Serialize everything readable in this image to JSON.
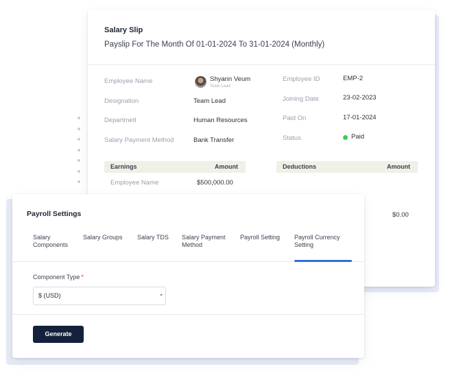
{
  "salary_slip": {
    "title": "Salary Slip",
    "subtitle": "Payslip For The Month Of 01-01-2024 To 31-01-2024 (Monthly)",
    "employee_name_label": "Employee Name",
    "employee_name": "Shyann Veum",
    "employee_role": "Team Lead",
    "designation_label": "Designation",
    "designation": "Team Lead",
    "department_label": "Departmetl",
    "department": "Human Resources",
    "payment_method_label": "Salary Payment Method",
    "payment_method": "Bank Transfer",
    "employee_id_label": "Employee ID",
    "employee_id": "EMP-2",
    "joining_date_label": "Joining Date",
    "joining_date": "23-02-2023",
    "paid_on_label": "Paid On",
    "paid_on": "17-01-2024",
    "status_label": "Status",
    "status": "Paid",
    "status_color": "#3ccf4e",
    "earnings": {
      "header_left": "Earnings",
      "header_right": "Amount",
      "rows": [
        {
          "label": "Employee Name",
          "amount": "$500,000.00"
        }
      ]
    },
    "deductions": {
      "header_left": "Deductions",
      "header_right": "Amount",
      "total": "$0.00"
    }
  },
  "payroll_settings": {
    "title": "Payroll Settings",
    "tabs": [
      {
        "line1": "Salary",
        "line2": "Components"
      },
      {
        "line1": "Salary Groups",
        "line2": ""
      },
      {
        "line1": "Salary TDS",
        "line2": ""
      },
      {
        "line1": "Salary Payment",
        "line2": "Method"
      },
      {
        "line1": "Payroll Setting",
        "line2": ""
      },
      {
        "line1": "Payroll Currency",
        "line2": "Setting"
      }
    ],
    "active_tab_index": 5,
    "accent_color": "#2f6fd6",
    "component_type_label": "Component Type",
    "required_mark": "*",
    "component_type_value": "$ (USD)",
    "generate_label": "Generate"
  }
}
